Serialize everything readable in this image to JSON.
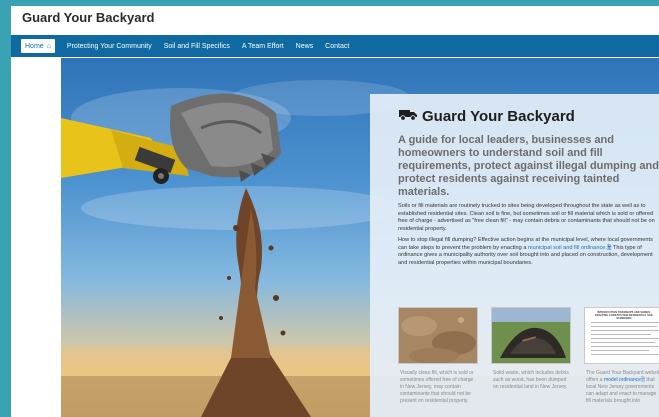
{
  "site": {
    "title": "Guard Your Backyard"
  },
  "nav": {
    "items": [
      {
        "label": "Home",
        "active": true
      },
      {
        "label": "Protecting Your Community"
      },
      {
        "label": "Soil and Fill Specifics"
      },
      {
        "label": "A Team Effort"
      },
      {
        "label": "News"
      },
      {
        "label": "Contact"
      }
    ]
  },
  "card": {
    "title": "Guard Your Backyard",
    "subtitle": "A guide for local leaders, businesses and homeowners to understand soil and fill requirements, protect against illegal dumping and protect residents against receiving tainted materials.",
    "para1": "Soils or fill materials are routinely trucked to sites being developed throughout the state as well as to established residential sites. Clean soil is fine, but sometimes soil or fill material which is sold or offered free of charge - advertised as \"free clean fill\" - may contain debris or contaminants that should not be on residential property.",
    "para2_before": "How to stop illegal fill dumping? Effective action begins at the municipal level, where local governments can take steps to prevent the problem by enacting a ",
    "para2_link": "municipal soil and fill ordinance.",
    "para2_after": " This type of ordinance gives a municipality authority over soil brought into and placed on construction, development and residential properties within municipal boundaries."
  },
  "thumbs": [
    {
      "caption": "Visually clean fill, which is sold or sometimes offered free of charge in New Jersey, may contain contaminants that should not be present on residential property."
    },
    {
      "caption": "Solid waste, which includes debris such as wood, has been dumped on residential land in New Jersey."
    },
    {
      "doc_heading": "INTRODUCTION TOWNSHIPS AND SHIRES: DRAFTING CONSTITUTION RESIDENTIAL SOIL SCREENING",
      "caption_before": "The Guard Your Backyard website offers a ",
      "caption_link": "model ordinance",
      "caption_after": " that local New Jersey governments can adapt and enact to manage fill materials brought into"
    }
  ],
  "colors": {
    "nav_bg": "#0e6aa0",
    "link": "#1a6ec2",
    "frame": "#3aa3b3"
  }
}
